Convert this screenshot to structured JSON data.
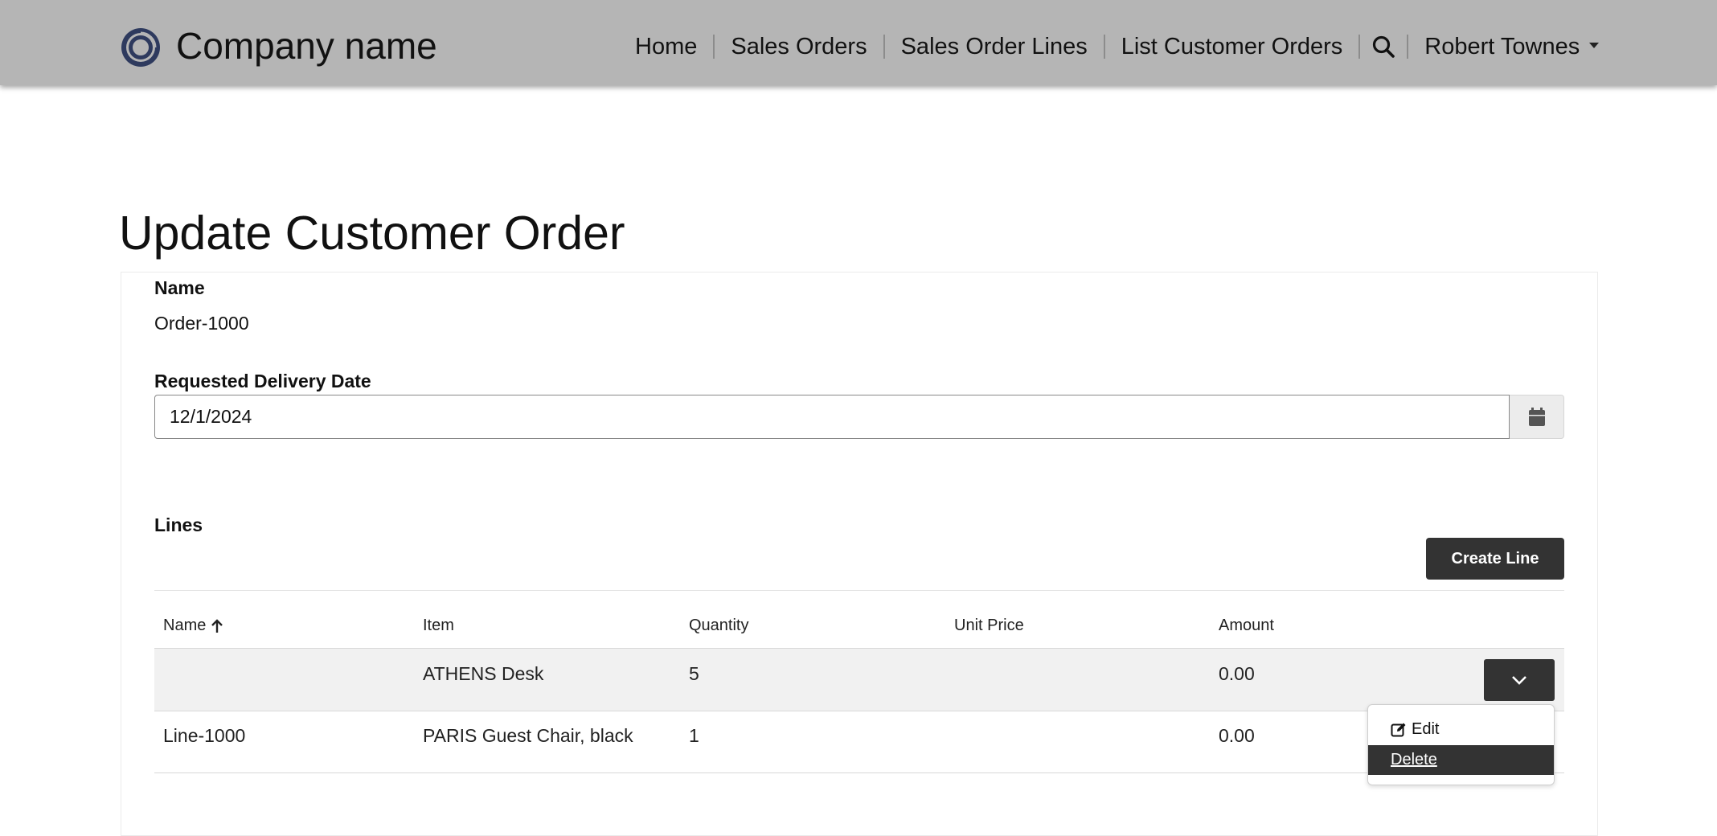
{
  "header": {
    "brand": "Company name",
    "nav": [
      "Home",
      "Sales Orders",
      "Sales Order Lines",
      "List Customer Orders"
    ],
    "search_icon": "search-icon",
    "user_name": "Robert Townes"
  },
  "page": {
    "title": "Update Customer Order"
  },
  "form": {
    "name_label": "Name",
    "name_value": "Order-1000",
    "date_label": "Requested Delivery Date",
    "date_value": "12/1/2024",
    "calendar_icon": "calendar-icon"
  },
  "lines": {
    "label": "Lines",
    "create_button": "Create Line",
    "columns": [
      "Name",
      "Item",
      "Quantity",
      "Unit Price",
      "Amount"
    ],
    "sort_icon": "arrow-up-icon",
    "rows": [
      {
        "name": "",
        "item": "ATHENS Desk",
        "quantity": "5",
        "unit_price": "",
        "amount": "0.00"
      },
      {
        "name": "Line-1000",
        "item": "PARIS Guest Chair, black",
        "quantity": "1",
        "unit_price": "",
        "amount": "0.00"
      }
    ]
  },
  "row_menu": {
    "edit": "Edit",
    "delete": "Delete"
  },
  "colors": {
    "header_bg": "#b5b5b5",
    "button_dark": "#333333",
    "row_shade": "#f1f1f1"
  }
}
